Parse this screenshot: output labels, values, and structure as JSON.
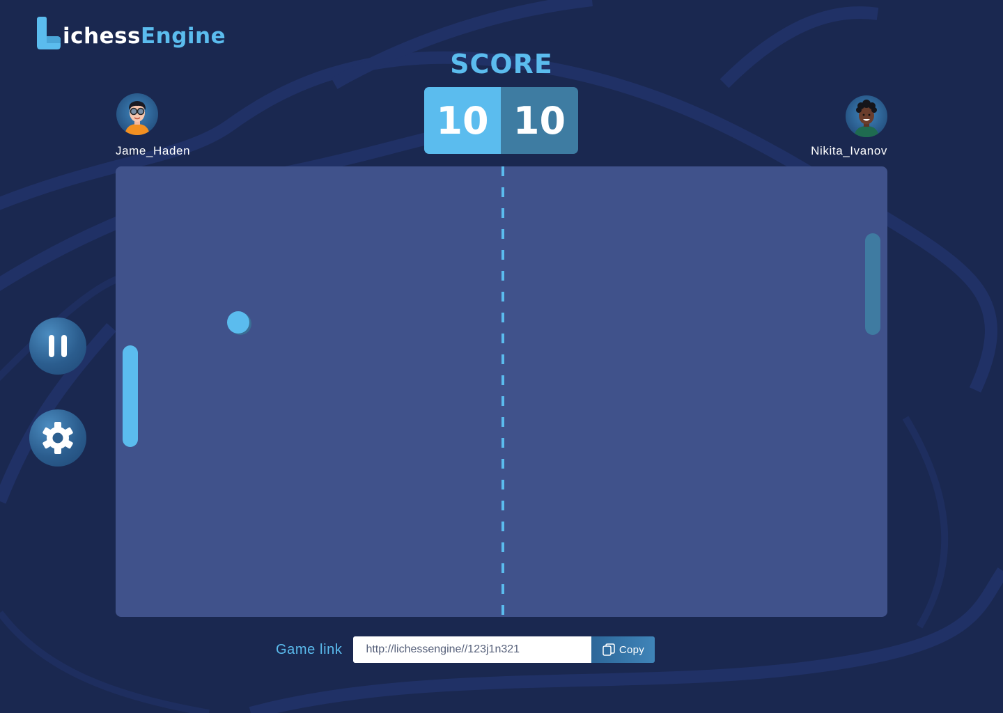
{
  "app": {
    "logo_text_primary": "ichess",
    "logo_text_accent": "Engine"
  },
  "score": {
    "title": "SCORE",
    "left": "10",
    "right": "10"
  },
  "players": {
    "left": {
      "name": "Jame_Haden",
      "avatar_icon": "player-avatar-icon"
    },
    "right": {
      "name": "Nikita_Ivanov",
      "avatar_icon": "player-avatar-icon"
    }
  },
  "controls": {
    "pause_icon": "pause-icon",
    "settings_icon": "gear-icon"
  },
  "game_link": {
    "label": "Game link",
    "value": "http://lichessengine//123j1n321",
    "copy_label": "Copy",
    "copy_icon": "copy-icon"
  },
  "colors": {
    "background": "#1a2850",
    "field": "#40528b",
    "accent": "#5bbcee",
    "accent_dark": "#3e7ca2"
  }
}
